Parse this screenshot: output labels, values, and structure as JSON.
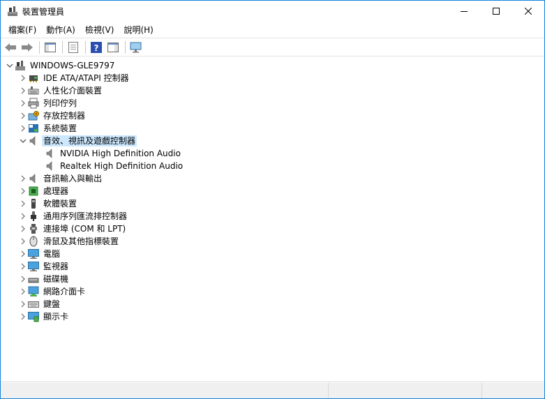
{
  "window": {
    "title": "裝置管理員",
    "accent": "#1883d7"
  },
  "menu": [
    {
      "label": "檔案(F)"
    },
    {
      "label": "動作(A)"
    },
    {
      "label": "檢視(V)"
    },
    {
      "label": "說明(H)"
    }
  ],
  "toolbar": {
    "buttons": [
      "back-arrow-icon",
      "forward-arrow-icon",
      "console-tree-icon",
      "properties-icon",
      "help-icon",
      "action-pane-icon",
      "computer-monitor-icon"
    ]
  },
  "tree": {
    "root": "WINDOWS-GLE9797",
    "categories": [
      {
        "label": "IDE ATA/ATAPI 控制器",
        "icon": "ide-controller-icon",
        "expanded": false
      },
      {
        "label": "人性化介面裝置",
        "icon": "hid-icon",
        "expanded": false
      },
      {
        "label": "列印佇列",
        "icon": "printer-icon",
        "expanded": false
      },
      {
        "label": "存放控制器",
        "icon": "storage-controller-icon",
        "expanded": false
      },
      {
        "label": "系統裝置",
        "icon": "system-device-icon",
        "expanded": false
      },
      {
        "label": "音效、視訊及遊戲控制器",
        "icon": "speaker-icon",
        "expanded": true,
        "selected": true,
        "children": [
          "NVIDIA High Definition Audio",
          "Realtek High Definition Audio"
        ]
      },
      {
        "label": "音訊輸入與輸出",
        "icon": "speaker-icon",
        "expanded": false
      },
      {
        "label": "處理器",
        "icon": "processor-icon",
        "expanded": false
      },
      {
        "label": "軟體裝置",
        "icon": "software-device-icon",
        "expanded": false
      },
      {
        "label": "通用序列匯流排控制器",
        "icon": "usb-icon",
        "expanded": false
      },
      {
        "label": "連接埠 (COM 和 LPT)",
        "icon": "port-icon",
        "expanded": false
      },
      {
        "label": "滑鼠及其他指標裝置",
        "icon": "mouse-icon",
        "expanded": false
      },
      {
        "label": "電腦",
        "icon": "computer-icon",
        "expanded": false
      },
      {
        "label": "監視器",
        "icon": "monitor-icon",
        "expanded": false
      },
      {
        "label": "磁碟機",
        "icon": "disk-drive-icon",
        "expanded": false
      },
      {
        "label": "網路介面卡",
        "icon": "network-adapter-icon",
        "expanded": false
      },
      {
        "label": "鍵盤",
        "icon": "keyboard-icon",
        "expanded": false
      },
      {
        "label": "顯示卡",
        "icon": "display-adapter-icon",
        "expanded": false
      }
    ]
  }
}
